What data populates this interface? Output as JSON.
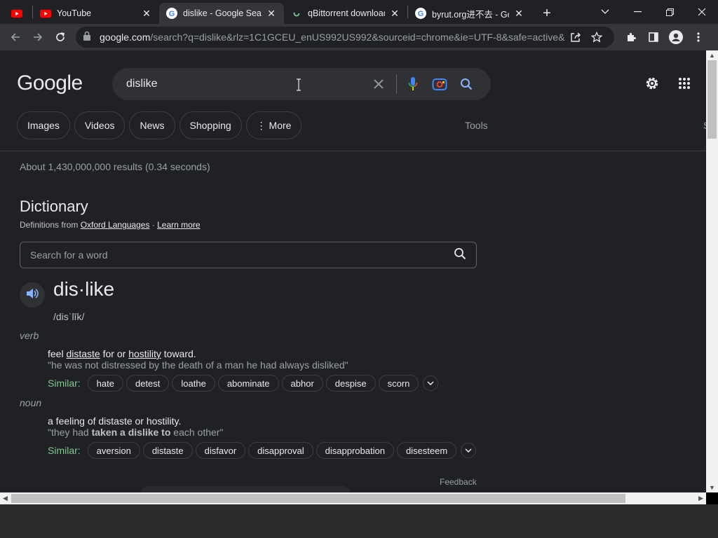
{
  "tabs": [
    {
      "title": "",
      "icon": "youtube-icon"
    },
    {
      "title": "YouTube",
      "icon": "youtube-icon"
    },
    {
      "title": "dislike - Google Search",
      "icon": "google-icon",
      "active": true
    },
    {
      "title": "qBittorrent download",
      "icon": "spinner-icon"
    },
    {
      "title": "byrut.org进不去 - Google",
      "icon": "google-icon"
    }
  ],
  "toolbar": {
    "url_host": "google.com",
    "url_path": "/search?q=dislike&rlz=1C1GCEU_enUS992US992&sourceid=chrome&ie=UTF-8&safe=active&s..."
  },
  "search": {
    "logo": "Google",
    "query": "dislike"
  },
  "chips": [
    "Images",
    "Videos",
    "News",
    "Shopping",
    "⋮ More"
  ],
  "tools": {
    "label": "Tools",
    "partial": "S"
  },
  "stats": "About 1,430,000,000 results (0.34 seconds)",
  "dictionary": {
    "title": "Dictionary",
    "source_prefix": "Definitions from ",
    "source_link": "Oxford Languages",
    "sep": " · ",
    "learn_more": "Learn more",
    "word_search_placeholder": "Search for a word",
    "headword": "dis·like",
    "pronunciation": "/disˈlīk/",
    "entries": [
      {
        "pos": "verb",
        "def_parts": [
          "feel ",
          "distaste",
          " for or ",
          "hostility",
          " toward."
        ],
        "example_parts": [
          "\"he was not distressed by the death of a man he had always disliked\""
        ],
        "similar_label": "Similar:",
        "similar": [
          "hate",
          "detest",
          "loathe",
          "abominate",
          "abhor",
          "despise",
          "scorn"
        ]
      },
      {
        "pos": "noun",
        "def_parts": [
          "a feeling of distaste or hostility."
        ],
        "example_parts": [
          "\"they had ",
          "taken a dislike to",
          " each other\""
        ],
        "similar_label": "Similar:",
        "similar": [
          "aversion",
          "distaste",
          "disfavor",
          "disapproval",
          "disapprobation",
          "disesteem"
        ]
      }
    ],
    "feedback": "Feedback"
  },
  "colors": {
    "background": "#202124",
    "chrome": "#35363a",
    "similar_label": "#81c995",
    "mic_blue": "#4285f4",
    "mic_red": "#ea4335",
    "search_blue": "#8ab4f8"
  }
}
